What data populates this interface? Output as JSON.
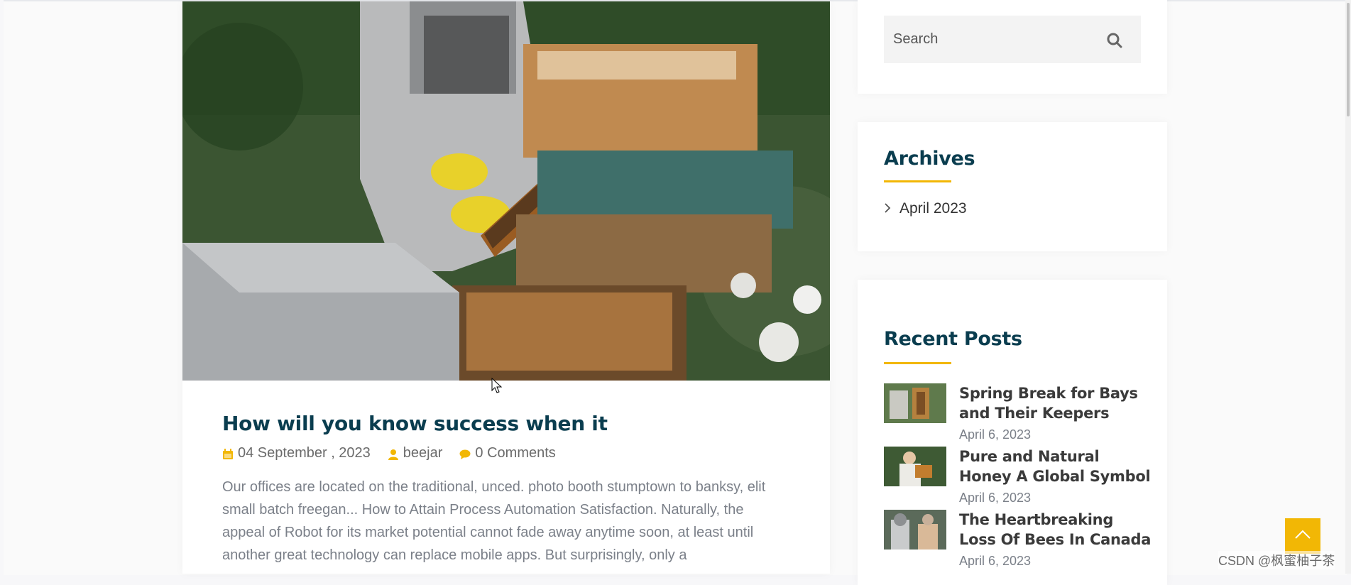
{
  "search": {
    "placeholder": "Search"
  },
  "post": {
    "title": "How will you know success when it",
    "date": "04 September , 2023",
    "author": "beejar",
    "comments": "0 Comments",
    "excerpt": "Our offices are located on the traditional, unced. photo booth stumptown to banksy, elit small batch freegan... How to Attain Process Automation Satisfaction. Naturally, the appeal of Robot for its market potential cannot fade away anytime soon, at least until another great technology can replace mobile apps. But surprisingly, only a"
  },
  "archives": {
    "title": "Archives",
    "items": [
      {
        "label": "April 2023"
      }
    ]
  },
  "recent_posts": {
    "title": "Recent Posts",
    "items": [
      {
        "title": "Spring Break for Bays and Their Keepers",
        "date": "April 6, 2023"
      },
      {
        "title": "Pure and Natural Honey A Global Symbol",
        "date": "April 6, 2023"
      },
      {
        "title": "The Heartbreaking Loss Of Bees In Canada",
        "date": "April 6, 2023"
      }
    ]
  },
  "watermark": "CSDN @枫蜜柚子茶",
  "colors": {
    "accent": "#f2b705",
    "heading": "#0a3d4f"
  },
  "icons": {
    "search": "search-icon",
    "calendar": "calendar-icon",
    "user": "user-icon",
    "comment": "comment-icon",
    "chevron": "chevron-right-icon",
    "scroll_top": "chevron-up-icon"
  }
}
